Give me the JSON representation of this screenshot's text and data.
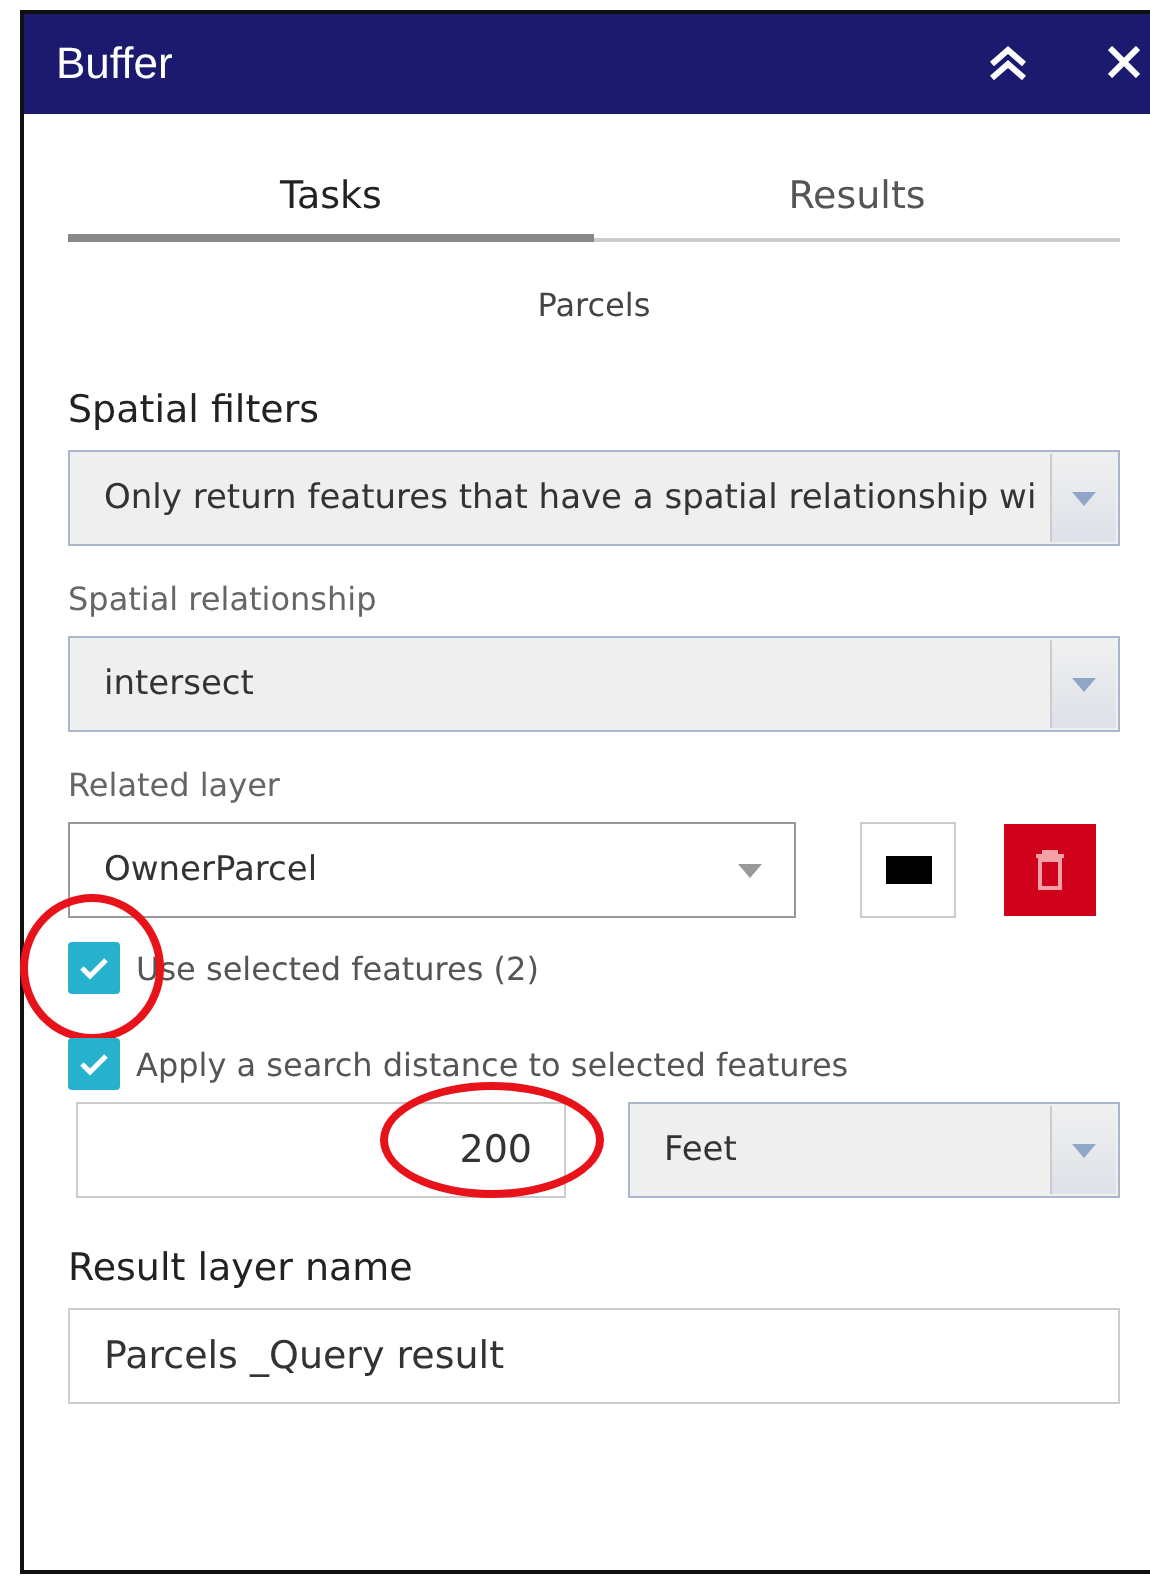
{
  "window": {
    "title": "Buffer",
    "buttons": [
      {
        "kind": "collapse"
      },
      {
        "kind": "close"
      }
    ]
  },
  "tabs": [
    {
      "label": "Tasks",
      "selected": true
    },
    {
      "label": "Results",
      "selected": false
    }
  ],
  "layer_name": "Parcels",
  "spatial_filters": {
    "heading": "Spatial filters",
    "value": "Only return features that have a spatial relationship wi"
  },
  "spatial_relationship": {
    "label": "Spatial relationship",
    "value": "intersect"
  },
  "related_layer": {
    "label": "Related layer",
    "value": "OwnerParcel"
  },
  "checkboxes": [
    {
      "label": "Use selected features (2)",
      "checked": true,
      "circled": true
    },
    {
      "label": "Apply a search distance to selected features",
      "checked": true,
      "circled": false
    }
  ],
  "distance": {
    "value": "200",
    "unit": "Feet",
    "circled": true
  },
  "result_layer": {
    "heading": "Result layer name",
    "value": "Parcels _Query result"
  }
}
